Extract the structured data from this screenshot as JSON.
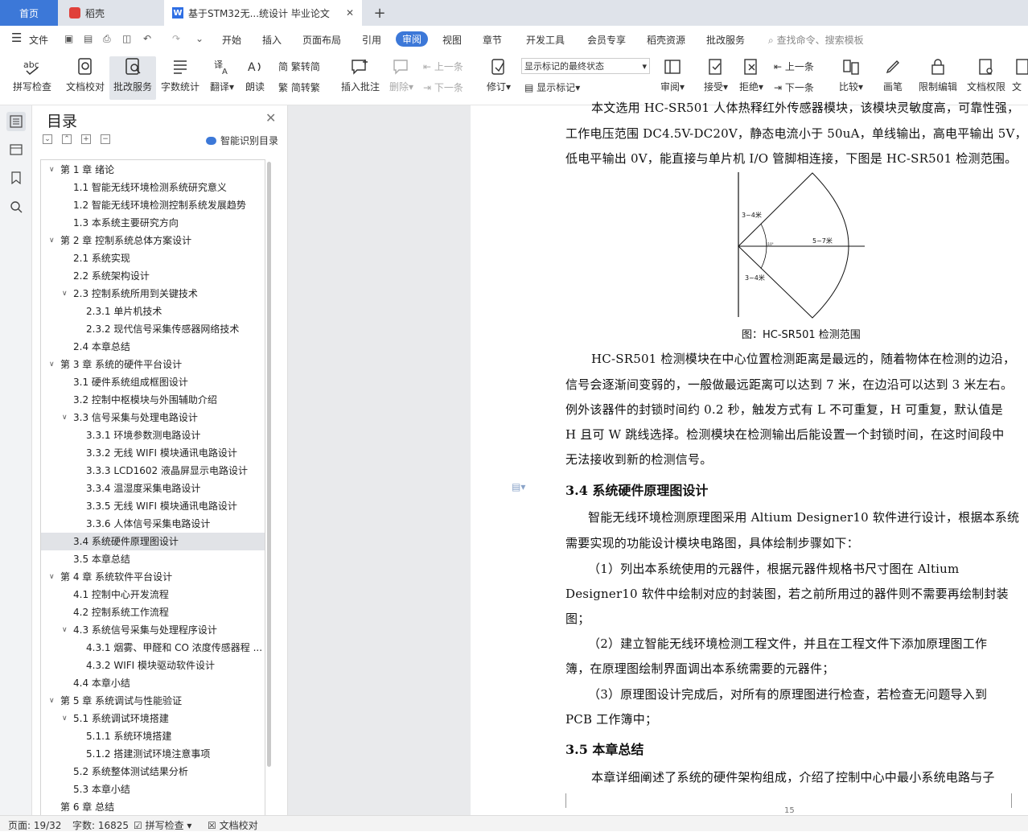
{
  "tabs": {
    "home": "首页",
    "daoke": "稻壳",
    "document": "基于STM32无...统设计 毕业论文"
  },
  "menu": {
    "file": "文件",
    "items": [
      "开始",
      "插入",
      "页面布局",
      "引用",
      "审阅",
      "视图",
      "章节",
      "开发工具",
      "会员专享",
      "稻壳资源",
      "批改服务"
    ],
    "search_placeholder": "查找命令、搜索模板"
  },
  "toolbar": {
    "spell_check": "拼写检查",
    "doc_proofread": "文档校对",
    "correction_service": "批改服务",
    "word_count": "字数统计",
    "translate": "翻译",
    "read_aloud": "朗读",
    "trad_to_simp": "繁转简",
    "simp_to_trad": "简转繁",
    "insert_comment": "插入批注",
    "delete": "删除",
    "prev": "上一条",
    "next": "下一条",
    "track_changes": "修订",
    "markup_state": "显示标记的最终状态",
    "show_markup": "显示标记",
    "review": "审阅",
    "accept": "接受",
    "reject": "拒绝",
    "prev2": "上一条",
    "next2": "下一条",
    "compare": "比较",
    "pen": "画笔",
    "restrict_edit": "限制编辑",
    "doc_rights": "文档权限",
    "doc_more": "文"
  },
  "toc": {
    "title": "目录",
    "smart_label": "智能识别目录",
    "items": [
      {
        "text": "第 1 章  绪论",
        "level": 1,
        "caret": true
      },
      {
        "text": "1.1 智能无线环境检测系统研究意义",
        "level": 2
      },
      {
        "text": "1.2 智能无线环境检测控制系统发展趋势",
        "level": 2
      },
      {
        "text": "1.3 本系统主要研究方向",
        "level": 2
      },
      {
        "text": "第 2 章  控制系统总体方案设计",
        "level": 1,
        "caret": true
      },
      {
        "text": "2.1 系统实现",
        "level": 2
      },
      {
        "text": "2.2 系统架构设计",
        "level": 2
      },
      {
        "text": "2.3 控制系统所用到关键技术",
        "level": 2,
        "caret": true
      },
      {
        "text": "2.3.1 单片机技术",
        "level": 3
      },
      {
        "text": "2.3.2 现代信号采集传感器网络技术",
        "level": 3
      },
      {
        "text": "2.4 本章总结",
        "level": 2
      },
      {
        "text": "第 3 章  系统的硬件平台设计",
        "level": 1,
        "caret": true
      },
      {
        "text": "3.1 硬件系统组成框图设计",
        "level": 2
      },
      {
        "text": "3.2 控制中枢模块与外围辅助介绍",
        "level": 2
      },
      {
        "text": "3.3 信号采集与处理电路设计",
        "level": 2,
        "caret": true
      },
      {
        "text": "3.3.1 环境参数测电路设计",
        "level": 3
      },
      {
        "text": "3.3.2 无线 WIFI 模块通讯电路设计",
        "level": 3
      },
      {
        "text": "3.3.3 LCD1602 液晶屏显示电路设计",
        "level": 3
      },
      {
        "text": "3.3.4 温湿度采集电路设计",
        "level": 3
      },
      {
        "text": "3.3.5 无线 WIFI 模块通讯电路设计",
        "level": 3
      },
      {
        "text": "3.3.6 人体信号采集电路设计",
        "level": 3
      },
      {
        "text": "3.4 系统硬件原理图设计",
        "level": 2,
        "selected": true
      },
      {
        "text": "3.5 本章总结",
        "level": 2
      },
      {
        "text": "第 4 章  系统软件平台设计",
        "level": 1,
        "caret": true
      },
      {
        "text": "4.1 控制中心开发流程",
        "level": 2
      },
      {
        "text": "4.2 控制系统工作流程",
        "level": 2
      },
      {
        "text": "4.3 系统信号采集与处理程序设计",
        "level": 2,
        "caret": true
      },
      {
        "text": "4.3.1 烟雾、甲醛和 CO 浓度传感器程 ...",
        "level": 3
      },
      {
        "text": "4.3.2 WIFI 模块驱动软件设计",
        "level": 3
      },
      {
        "text": "4.4 本章小结",
        "level": 2
      },
      {
        "text": "第 5 章  系统调试与性能验证",
        "level": 1,
        "caret": true
      },
      {
        "text": "5.1 系统调试环境搭建",
        "level": 2,
        "caret": true
      },
      {
        "text": "5.1.1 系统环境搭建",
        "level": 3
      },
      {
        "text": "5.1.2 搭建测试环境注意事项",
        "level": 3
      },
      {
        "text": "5.2 系统整体测试结果分析",
        "level": 2
      },
      {
        "text": "5.3 本章小结",
        "level": 2
      },
      {
        "text": "第 6 章  总结",
        "level": 1
      }
    ]
  },
  "document": {
    "lines_top": [
      "本文选用 HC-SR501 人体热释红外传感器模块，该模块灵敏度高，可靠性强，",
      "工作电压范围 DC4.5V-DC20V，静态电流小于 50uA，单线输出，高电平输出 5V，",
      "低电平输出 0V，能直接与单片机 I/O 管脚相连接，下图是 HC-SR501 检测范围。"
    ],
    "figure_labels": {
      "top": "3~4米",
      "right": "5~7米",
      "bottom": "3~4米",
      "angle": "110°"
    },
    "figure_caption": "图：HC-SR501 检测范围",
    "para2": [
      "HC-SR501 检测模块在中心位置检测距离是最远的，随着物体在检测的边沿，",
      "信号会逐渐间变弱的，一般做最远距离可以达到 7 米，在边沿可以达到 3 米左右。",
      "例外该器件的封锁时间约 0.2 秒，触发方式有 L 不可重复，H 可重复，默认值是",
      "H 且可 W 跳线选择。检测模块在检测输出后能设置一个封锁时间，在这时间段中",
      "无法接收到新的检测信号。"
    ],
    "heading_34": "3.4 系统硬件原理图设计",
    "para3": [
      "智能无线环境检测原理图采用 Altium Designer10 软件进行设计，根据本系统",
      "需要实现的功能设计模块电路图，具体绘制步骤如下：",
      "（1）列出本系统使用的元器件，根据元器件规格书尺寸图在 Altium",
      "Designer10 软件中绘制对应的封装图，若之前所用过的器件则不需要再绘制封装",
      "图；",
      "（2）建立智能无线环境检测工程文件，并且在工程文件下添加原理图工作",
      "簿，在原理图绘制界面调出本系统需要的元器件；",
      "（3）原理图设计完成后，对所有的原理图进行检查，若检查无问题导入到",
      "PCB 工作簿中；"
    ],
    "heading_35": "3.5 本章总结",
    "para4": "本章详细阐述了系统的硬件架构组成，介绍了控制中心中最小系统电路与子",
    "page_number": "15"
  },
  "status": {
    "page": "页面: 19/32",
    "words": "字数: 16825",
    "spell": "拼写检查",
    "proof": "文档校对"
  }
}
